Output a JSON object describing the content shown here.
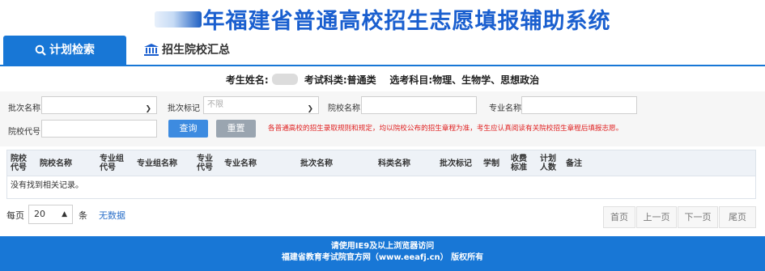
{
  "header": {
    "title": "年福建省普通高校招生志愿填报辅助系统"
  },
  "tabs": [
    {
      "label": "计划检索",
      "icon": "search-icon",
      "active": true
    },
    {
      "label": "招生院校汇总",
      "icon": "institution-icon",
      "active": false
    }
  ],
  "student": {
    "name_label": "考生姓名:",
    "exam_type_label": "考试科类:",
    "exam_type_value": "普通类",
    "subjects_label": "选考科目:",
    "subjects_value": "物理、生物学、思想政治"
  },
  "filters": {
    "batch_name_label": "批次名称",
    "batch_name_value": "",
    "batch_mark_label": "批次标记",
    "batch_mark_value": "不限",
    "school_name_label": "院校名称",
    "school_name_value": "",
    "major_name_label": "专业名称",
    "major_name_value": "",
    "school_code_label": "院校代号",
    "school_code_value": "",
    "query_button": "查询",
    "reset_button": "重置",
    "notice": "各普通高校的招生录取规则和规定，均以院校公布的招生章程为准，考生应认真阅读有关院校招生章程后填报志愿。"
  },
  "table": {
    "headers": [
      "院校代号",
      "院校名称",
      "专业组代号",
      "专业组名称",
      "专业代号",
      "专业名称",
      "批次名称",
      "科类名称",
      "批次标记",
      "学制",
      "收费标准",
      "计划人数",
      "备注"
    ],
    "empty_text": "没有找到相关记录。"
  },
  "pagination": {
    "per_page_label": "每页",
    "per_page_value": "20",
    "unit_label": "条",
    "no_data": "无数据",
    "first": "首页",
    "prev": "上一页",
    "next": "下一页",
    "last": "尾页"
  },
  "footer": {
    "line1": "请使用IE9及以上浏览器访问",
    "line2": "福建省教育考试院官方网（www.eeafj.cn） 版权所有"
  },
  "colors": {
    "primary": "#1877d6",
    "notice": "#e02020"
  }
}
